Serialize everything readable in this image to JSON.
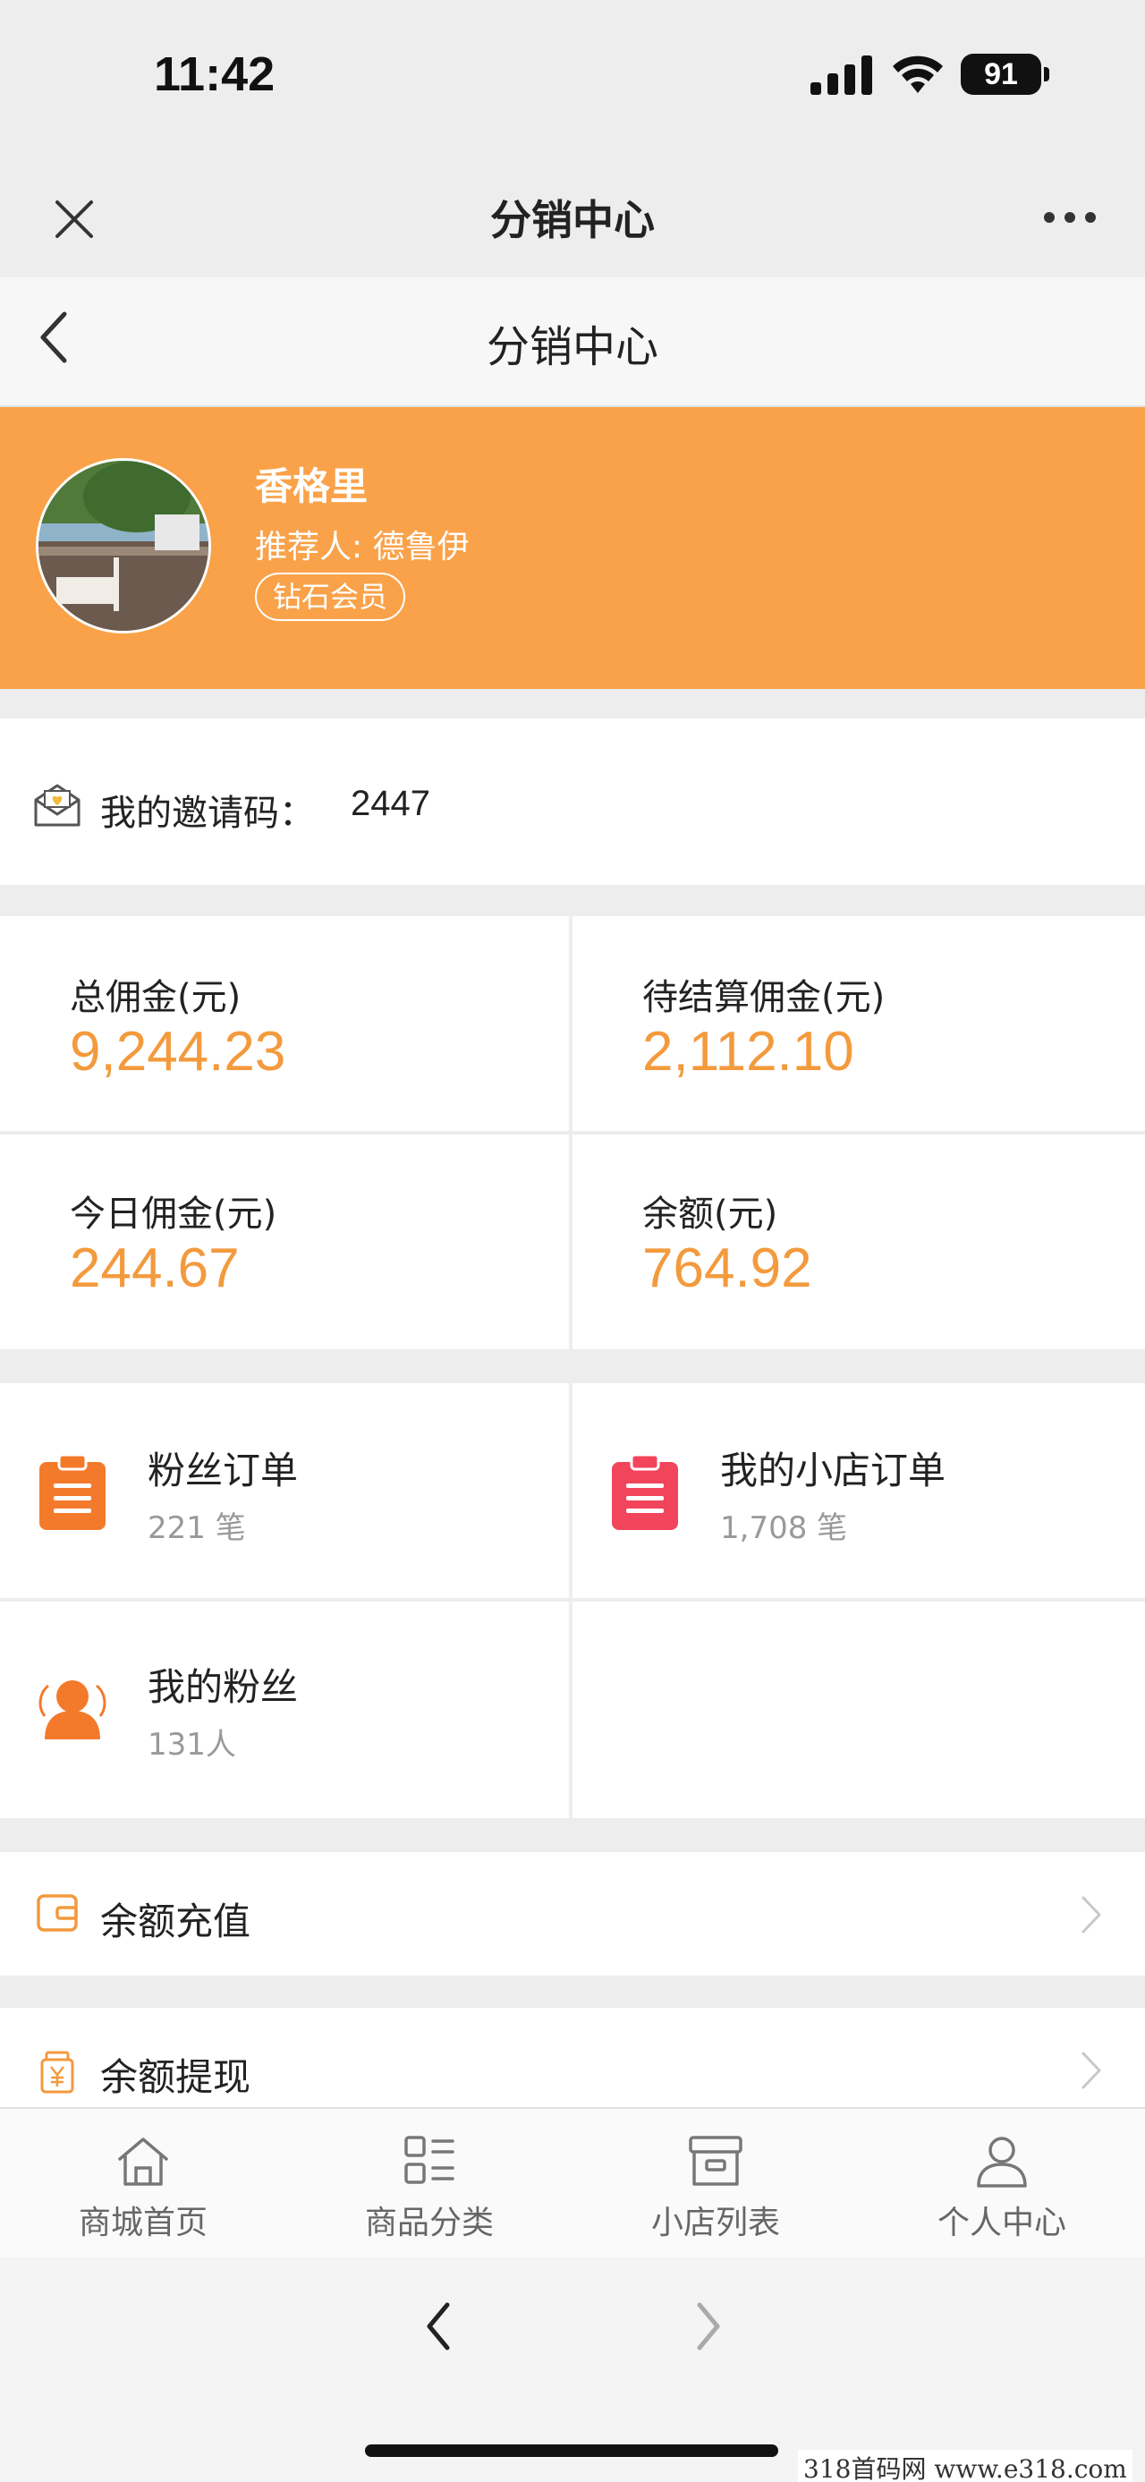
{
  "status_bar": {
    "time": "11:42",
    "battery": "91"
  },
  "webview": {
    "title": "分销中心"
  },
  "nav": {
    "title": "分销中心"
  },
  "profile": {
    "name": "香格里",
    "referrer": "推荐人: 德鲁伊",
    "level": "钻石会员"
  },
  "invite": {
    "label": "我的邀请码：",
    "code": "2447"
  },
  "commission": {
    "total": {
      "label": "总佣金(元)",
      "value": "9,244.23"
    },
    "pending": {
      "label": "待结算佣金(元)",
      "value": "2,112.10"
    },
    "today": {
      "label": "今日佣金(元)",
      "value": "244.67"
    },
    "balance": {
      "label": "余额(元)",
      "value": "764.92"
    }
  },
  "orders": {
    "fan_orders": {
      "title": "粉丝订单",
      "sub": "221 笔",
      "color": "#f47a2b"
    },
    "shop_orders": {
      "title": "我的小店订单",
      "sub": "1,708 笔",
      "color": "#f2445b"
    },
    "my_fans": {
      "title": "我的粉丝",
      "sub": "131人",
      "color": "#f47a2b"
    }
  },
  "menu": {
    "recharge": {
      "label": "余额充值"
    },
    "withdraw": {
      "label": "余额提现"
    }
  },
  "tabs": [
    {
      "label": "商城首页",
      "icon": "home-icon"
    },
    {
      "label": "商品分类",
      "icon": "category-icon"
    },
    {
      "label": "小店列表",
      "icon": "store-box-icon"
    },
    {
      "label": "个人中心",
      "icon": "user-icon"
    }
  ],
  "watermark": "318首码网  www.e318.com",
  "colors": {
    "accent": "#f9a24a",
    "value": "#f39a3d"
  }
}
